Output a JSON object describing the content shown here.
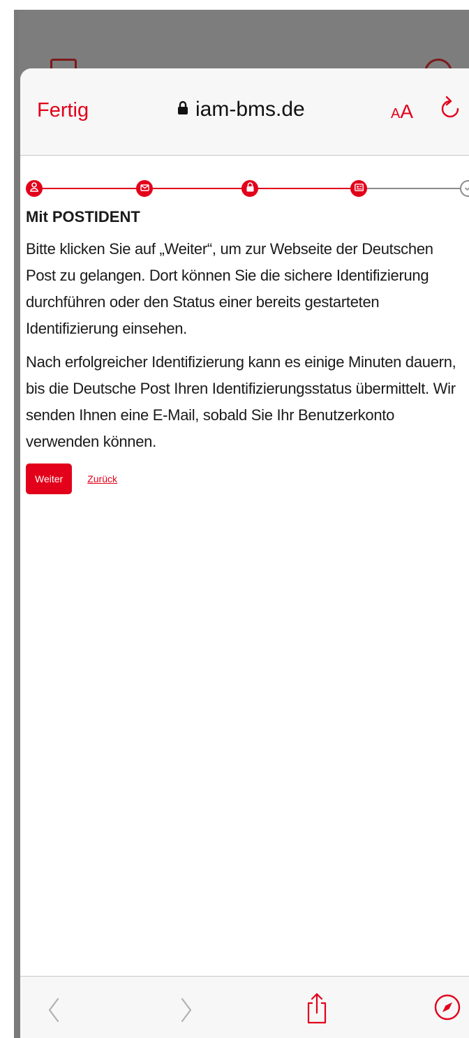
{
  "header": {
    "done_label": "Fertig",
    "domain": "iam-bms.de",
    "text_size_small": "A",
    "text_size_big": "A"
  },
  "stepper": {
    "steps": [
      {
        "icon": "user-icon",
        "state": "complete"
      },
      {
        "icon": "mail-icon",
        "state": "complete"
      },
      {
        "icon": "lock-icon",
        "state": "complete"
      },
      {
        "icon": "id-card-icon",
        "state": "current"
      },
      {
        "icon": "check-icon",
        "state": "pending"
      }
    ],
    "active_color": "#e2001a",
    "inactive_color": "#8a8a8a"
  },
  "content": {
    "title": "Mit POSTIDENT",
    "paragraph1": "Bitte klicken Sie auf „Weiter“, um zur Webseite der Deutschen Post zu gelangen. Dort können Sie die sichere Identifizierung durchführen oder den Status einer bereits gestarteten Identifizierung einsehen.",
    "paragraph2": "Nach erfolgreicher Identifizierung kann es einige Minuten dauern, bis die Deutsche Post Ihren Identifizierungsstatus übermittelt. Wir senden Ihnen eine E-Mail, sobald Sie Ihr Benutzerkonto verwenden können.",
    "continue_label": "Weiter",
    "back_label": "Zurück"
  },
  "toolbar": {
    "items": [
      "back-icon",
      "forward-icon",
      "share-icon",
      "compass-icon"
    ]
  },
  "colors": {
    "accent": "#e2001a",
    "backdrop": "#7d7d7d"
  }
}
